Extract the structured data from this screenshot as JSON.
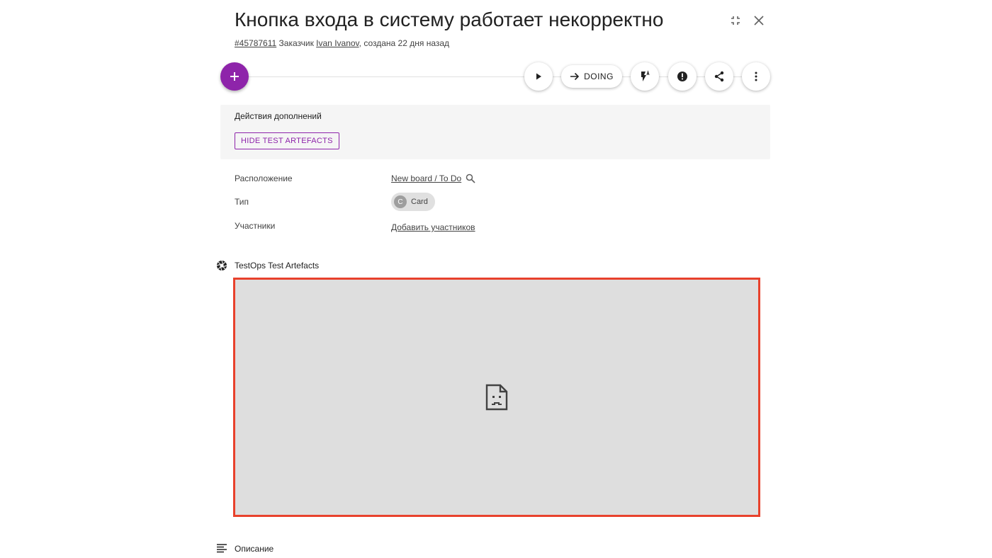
{
  "header": {
    "title": "Кнопка входа в систему работает некорректно",
    "card_id": "#45787611",
    "customer_prefix": "Заказчик",
    "customer_name": "Ivan Ivanov",
    "created_text": ", создана 22 дня назад",
    "collapse_icon": "collapse-icon",
    "close_icon": "close-icon"
  },
  "toolbar": {
    "fab_icon": "plus-icon",
    "play_icon": "play-icon",
    "status_label": "DOING",
    "status_icon": "arrow-right-icon",
    "flash_icon": "flash-auto-icon",
    "alert_icon": "alert-circle-icon",
    "share_icon": "share-icon",
    "more_icon": "more-vert-icon"
  },
  "addons": {
    "title": "Действия дополнений",
    "hide_button_label": "HIDE TEST ARTEFACTS"
  },
  "properties": {
    "location_label": "Расположение",
    "location_value": "New board / To Do",
    "type_label": "Тип",
    "type_chip_letter": "C",
    "type_chip_label": "Card",
    "members_label": "Участники",
    "members_link": "Добавить участников"
  },
  "sections": {
    "artefacts_title": "TestOps Test Artefacts",
    "artefacts_icon": "aperture-icon",
    "description_title": "Описание",
    "description_icon": "text-lines-icon"
  },
  "colors": {
    "accent": "#8e24aa",
    "frame_border": "#e8412c",
    "frame_bg": "#dedede"
  }
}
